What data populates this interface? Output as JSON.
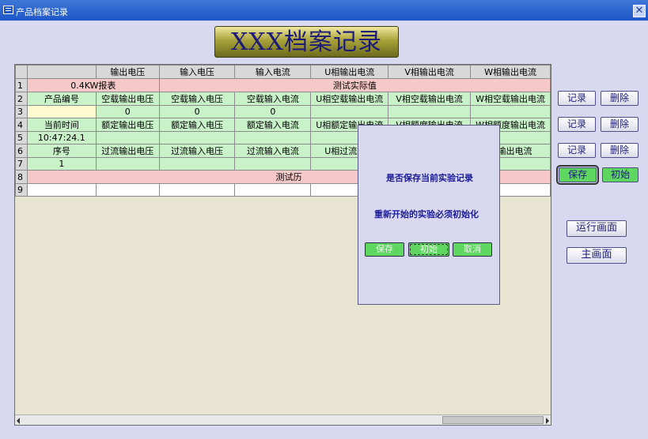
{
  "window": {
    "title": "产品档案记录",
    "close": "✕"
  },
  "banner": "XXX档案记录",
  "grid": {
    "headers": [
      "",
      "输出电压",
      "输入电压",
      "输入电流",
      "U相输出电流",
      "V相输出电流",
      "W相输出电流"
    ],
    "rows": [
      [
        "1",
        "0.4KW报表",
        "",
        "",
        "测试实际值",
        "",
        ""
      ],
      [
        "2",
        "产品编号",
        "空载输出电压",
        "空载输入电压",
        "空载输入电流",
        "U相空载输出电流",
        "V相空载输出电流",
        "W相空载输出电流"
      ],
      [
        "3",
        "",
        "0",
        "0",
        "0",
        "",
        "",
        ""
      ],
      [
        "4",
        "当前时间",
        "额定输出电压",
        "额定输入电压",
        "额定输入电流",
        "U相额定输出电流",
        "V相额度输出电流",
        "W相额度输出电流"
      ],
      [
        "5",
        "10:47:24.1",
        "",
        "",
        "",
        "",
        "",
        ""
      ],
      [
        "6",
        "序号",
        "过流输出电压",
        "过流输入电压",
        "过流输入电流",
        "U相过流输出",
        "",
        "流输出电流"
      ],
      [
        "7",
        "1",
        "",
        "",
        "",
        "",
        "",
        ""
      ],
      [
        "8",
        "",
        "",
        "",
        "",
        "测试历",
        "",
        ""
      ],
      [
        "9",
        "",
        "",
        "",
        "",
        "",
        "",
        ""
      ]
    ]
  },
  "side": {
    "record": "记录",
    "delete": "删除",
    "save": "保存",
    "init": "初始",
    "run": "运行画面",
    "main": "主画面"
  },
  "dialog": {
    "line1": "是否保存当前实验记录",
    "line2": "重新开始的实验必须初始化",
    "save": "保存",
    "init": "初始",
    "cancel": "取消"
  }
}
